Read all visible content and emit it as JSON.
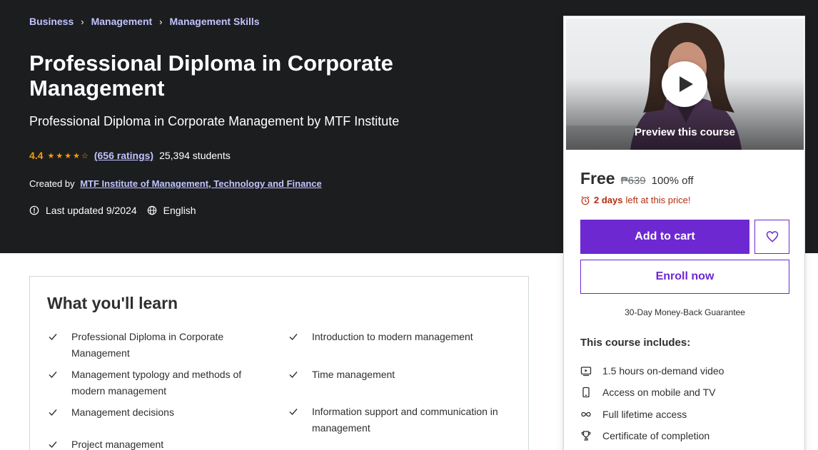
{
  "breadcrumb": [
    "Business",
    "Management",
    "Management Skills"
  ],
  "course": {
    "title": "Professional Diploma in Corporate Management",
    "subtitle": "Professional Diploma in Corporate Management by MTF Institute",
    "rating": "4.4",
    "ratings_count": "(656 ratings)",
    "students": "25,394 students",
    "created_label": "Created by",
    "creator": "MTF Institute of Management, Technology and Finance",
    "last_updated": "Last updated 9/2024",
    "language": "English"
  },
  "sidebar": {
    "preview_label": "Preview this course",
    "price": "Free",
    "old_price": "₱639",
    "discount": "100% off",
    "deadline_bold": "2 days",
    "deadline_rest": "left at this price!",
    "add_to_cart": "Add to cart",
    "enroll": "Enroll now",
    "guarantee": "30-Day Money-Back Guarantee",
    "includes_title": "This course includes:",
    "includes": [
      {
        "icon": "video-icon",
        "label": "1.5 hours on-demand video"
      },
      {
        "icon": "mobile-icon",
        "label": "Access on mobile and TV"
      },
      {
        "icon": "infinity-icon",
        "label": "Full lifetime access"
      },
      {
        "icon": "trophy-icon",
        "label": "Certificate of completion"
      }
    ]
  },
  "learn": {
    "heading": "What you'll learn",
    "left": [
      "Professional Diploma in Corporate Management",
      "Management typology and methods of modern management",
      "Management decisions",
      "Project management"
    ],
    "right": [
      "Introduction to modern management",
      "Time management",
      "Information support and communication in management"
    ]
  },
  "colors": {
    "hero_bg": "#1c1d1f",
    "accent": "#6d28d2",
    "link": "#c0c4fc",
    "star": "#f69c08",
    "alert": "#b32d0f"
  }
}
